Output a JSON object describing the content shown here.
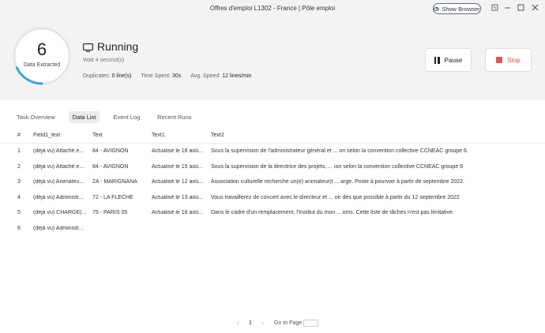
{
  "window": {
    "title": "Offres d'emploi L1302 - France | Pôle emploi",
    "show_browser_label": "Show Browser"
  },
  "header": {
    "count": "6",
    "count_caption": "Data Extracted",
    "status": "Running",
    "wait": "Wait 4 second(s)",
    "duplicates_label": "Duplicates:",
    "duplicates_value": "0 line(s)",
    "time_label": "Time Spent:",
    "time_value": "30s",
    "speed_label": "Avg. Speed:",
    "speed_value": "12 lines/min",
    "progress_fraction": 0.18,
    "accent_color": "#3ba7e3",
    "pause_label": "Pause",
    "stop_label": "Stop",
    "stop_color": "#e05656"
  },
  "tabs": [
    {
      "label": "Task Overview",
      "active": false
    },
    {
      "label": "Data List",
      "active": true
    },
    {
      "label": "Event Log",
      "active": false
    },
    {
      "label": "Recent Runs",
      "active": false
    }
  ],
  "table": {
    "headers": [
      "#",
      "Field1_text",
      "Text",
      "Text1",
      "Text2"
    ],
    "rows": [
      [
        "1",
        "(déjà vu) Attaché.e...",
        "84 - AVIGNON",
        "Actualisé le 16 aoû...",
        "Sous la supervision de l'administrateur général et ... on selon la convention collective CCNEAC groupe 6."
      ],
      [
        "2",
        "(déjà vu) Attaché.e...",
        "84 - AVIGNON",
        "Actualisé le 15 aoû...",
        "Sous la supervision de la directrice des projets, ... ion selon la convention collective CCNEAC groupe 6"
      ],
      [
        "3",
        "(déjà vu) Animateu...",
        "2A - MARIGNANA",
        "Actualisé le 12 aoû...",
        "Association culturelle recherche un(e) animateur(t ... arge. Poste à pourvoir à partir de septembre 2022."
      ],
      [
        "4",
        "(déjà vu) Administr...",
        "72 - LA FLECHE",
        "Actualisé le 13 aoû...",
        "Vous travaillerez de concert avec le directeur et ... oir dès que possible à partir du 12 septembre 2022"
      ],
      [
        "5",
        "(déjà vu) CHARGÉ(...",
        "75 - PARIS 05",
        "Actualisé le 16 aoû...",
        "Dans le cadre d'un remplacement, l'Institut du mon ... ions. Cette liste de tâches n'est pas limitative."
      ],
      [
        "6",
        "(déjà vu) Administr...",
        "",
        "",
        ""
      ]
    ]
  },
  "pager": {
    "prev": "‹",
    "page": "1",
    "next": "›",
    "goto_label": "Go to Page"
  },
  "icons": {
    "eye": "eye-icon",
    "monitor": "monitor-icon",
    "pause": "pause-icon",
    "stop": "stop-icon"
  }
}
